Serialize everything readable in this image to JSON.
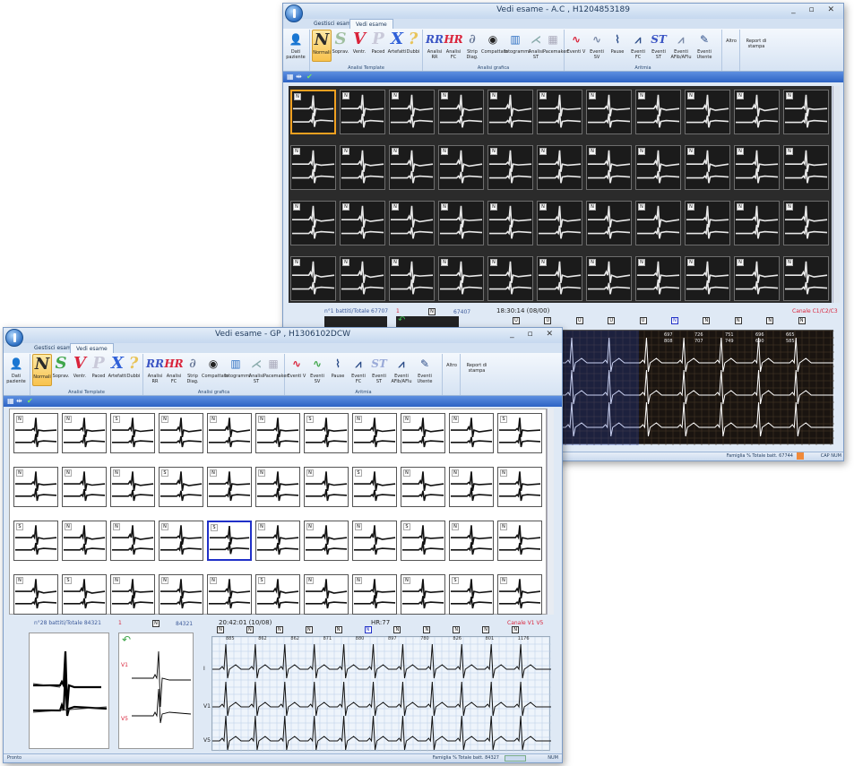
{
  "windowA": {
    "title": "Vedi esame - A.C , H1204853189",
    "tabs": [
      "Gestisci esame",
      "Vedi esame"
    ],
    "ribbon": {
      "patient_btn": "Dati paziente",
      "template_buttons": [
        {
          "glyph": "N",
          "label": "Normali"
        },
        {
          "glyph": "S",
          "label": "Soprav."
        },
        {
          "glyph": "V",
          "label": "Ventr."
        },
        {
          "glyph": "P",
          "label": "Paced"
        },
        {
          "glyph": "X",
          "label": "Artefatti"
        },
        {
          "glyph": "?",
          "label": "Dubbi"
        }
      ],
      "template_group": "Analisi Template",
      "graph_buttons": [
        {
          "glyph": "RR",
          "label": "Analisi RR"
        },
        {
          "glyph": "HR",
          "label": "Analisi FC"
        },
        {
          "glyph": "Strip",
          "label": "Strip Diag."
        },
        {
          "glyph": "Compattato",
          "label": "Compattato"
        },
        {
          "glyph": "Istogrammi",
          "label": "Istogrammi"
        },
        {
          "glyph": "ST",
          "label": "Analisi ST"
        },
        {
          "glyph": "PM",
          "label": "Pacemaker"
        }
      ],
      "graph_group": "Analisi grafica",
      "event_buttons": [
        {
          "label": "Eventi V"
        },
        {
          "label": "Eventi SV"
        },
        {
          "label": "Pause"
        },
        {
          "label": "Eventi FC"
        },
        {
          "label": "Eventi ST"
        },
        {
          "label": "Eventi AFib/AFlu"
        },
        {
          "label": "Eventi Utente"
        }
      ],
      "event_group": "Aritmia",
      "altro": "Altro",
      "report": "Report di stampa"
    },
    "lower": {
      "counter": "n°1 battiti/Totale 67707",
      "mid_label": "1",
      "mid_N": "N",
      "mid_count": "67407",
      "time": "18:30:14 (08/00)",
      "channel": "Canale C1/C2/C3"
    },
    "strip_labels": [
      "U",
      "U",
      "U",
      "U",
      "U",
      "N",
      "N",
      "N",
      "N",
      "N"
    ],
    "rr_values": [
      "697",
      "726",
      "751",
      "696",
      "665"
    ],
    "rr_values2": [
      "808",
      "707",
      "749",
      "690",
      "585"
    ],
    "status": "Famiglia % Totale batt. 67744",
    "status_right": "CAP  NUM"
  },
  "windowB": {
    "title": "Vedi esame - GP , H1306102DCW",
    "tabs": [
      "Gestisci esame",
      "Vedi esame"
    ],
    "lower": {
      "counter": "n°28 battiti/Totale 84321",
      "mid_label": "1",
      "mid_N": "N",
      "mid_count": "84321",
      "time": "20:42:01 (10/08)",
      "hr": "HR:77",
      "channel": "Canale V1 V5",
      "lead_V1": "V1",
      "lead_V5": "V5"
    },
    "strip_labels": [
      "N",
      "N",
      "N",
      "N",
      "N",
      "N",
      "N",
      "N",
      "N",
      "N",
      "N"
    ],
    "rr_values": [
      "885",
      "862",
      "862",
      "871",
      "880",
      "897",
      "780",
      "826",
      "801",
      "1176"
    ],
    "lead_names": [
      "I",
      "V1",
      "V5"
    ],
    "status_left": "Pronto",
    "status": "Famiglia % Totale batt. 84327",
    "status_right": "NUM"
  },
  "colors": {
    "accent_orange": "#f0a020",
    "accent_blue": "#2030c8",
    "ribbon_blue": "#2d63c4"
  }
}
